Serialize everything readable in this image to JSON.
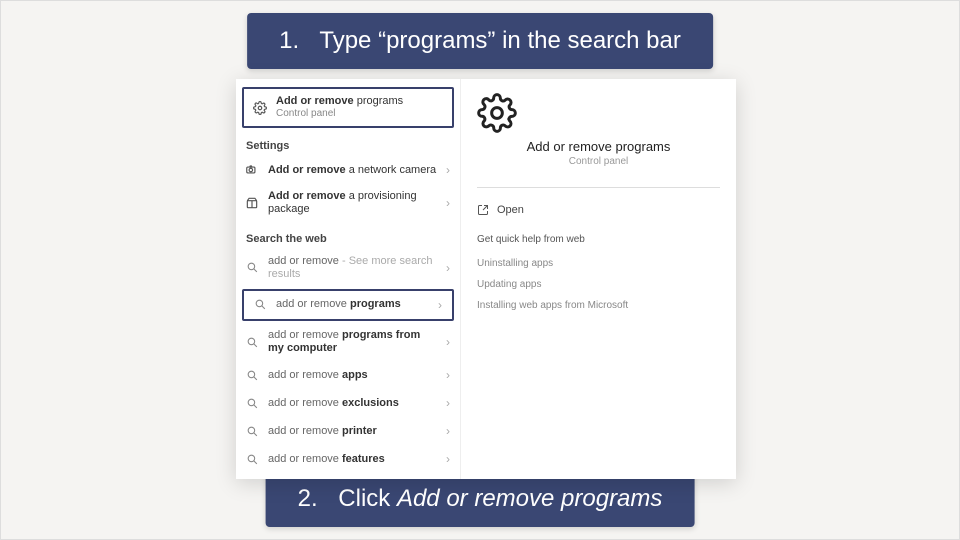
{
  "callouts": {
    "top_num": "1.",
    "top_text": "Type “programs” in the search bar",
    "bottom_num": "2.",
    "bottom_prefix": "Click ",
    "bottom_em": "Add or remove programs"
  },
  "left": {
    "primary": {
      "bold": "Add or remove",
      "rest": " programs",
      "sub": "Control panel"
    },
    "settings_header": "Settings",
    "settings": [
      {
        "bold": "Add or remove",
        "rest": " a network camera"
      },
      {
        "bold": "Add or remove",
        "rest": " a provisioning package"
      }
    ],
    "web_header": "Search the web",
    "web": [
      {
        "pre": "add or remove",
        "bold": "",
        "tail": " - See more search results"
      },
      {
        "pre": "add or remove ",
        "bold": "programs",
        "tail": ""
      },
      {
        "pre": "add or remove ",
        "bold": "programs from my computer",
        "tail": ""
      },
      {
        "pre": "add or remove ",
        "bold": "apps",
        "tail": ""
      },
      {
        "pre": "add or remove ",
        "bold": "exclusions",
        "tail": ""
      },
      {
        "pre": "add or remove ",
        "bold": "printer",
        "tail": ""
      },
      {
        "pre": "add or remove ",
        "bold": "features",
        "tail": ""
      }
    ]
  },
  "right": {
    "title": "Add or remove programs",
    "sub": "Control panel",
    "open": "Open",
    "help_header": "Get quick help from web",
    "help_links": [
      "Uninstalling apps",
      "Updating apps",
      "Installing web apps from Microsoft"
    ]
  }
}
